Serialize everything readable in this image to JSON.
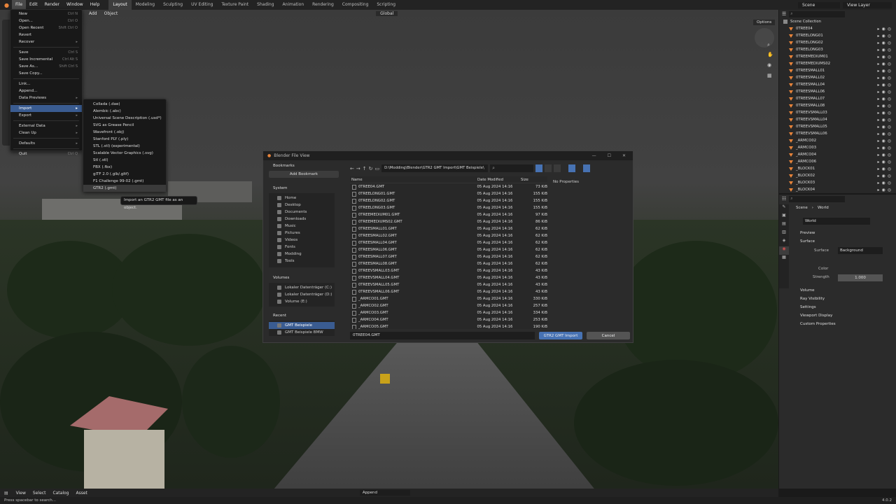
{
  "topbar": {
    "menus": [
      "File",
      "Edit",
      "Render",
      "Window",
      "Help"
    ],
    "workspaces": [
      "Layout",
      "Modeling",
      "Sculpting",
      "UV Editing",
      "Texture Paint",
      "Shading",
      "Animation",
      "Rendering",
      "Compositing",
      "Scripting"
    ],
    "scene": "Scene",
    "view_layer": "View Layer"
  },
  "viewport": {
    "add": "Add",
    "object": "Object",
    "orientation": "Global",
    "options": "Options"
  },
  "file_menu": [
    {
      "label": "New",
      "shortcut": "Ctrl N"
    },
    {
      "label": "Open...",
      "shortcut": "Ctrl O"
    },
    {
      "label": "Open Recent",
      "shortcut": "Shift Ctrl O"
    },
    {
      "label": "Revert",
      "shortcut": ""
    },
    {
      "label": "Recover",
      "shortcut": ""
    },
    {
      "label": "Save",
      "shortcut": "Ctrl S"
    },
    {
      "label": "Save Incremental",
      "shortcut": "Ctrl Alt S"
    },
    {
      "label": "Save As...",
      "shortcut": "Shift Ctrl S"
    },
    {
      "label": "Save Copy...",
      "shortcut": ""
    },
    {
      "label": "Link...",
      "shortcut": ""
    },
    {
      "label": "Append...",
      "shortcut": ""
    },
    {
      "label": "Data Previews",
      "shortcut": ""
    },
    {
      "label": "Import",
      "shortcut": ""
    },
    {
      "label": "Export",
      "shortcut": ""
    },
    {
      "label": "External Data",
      "shortcut": ""
    },
    {
      "label": "Clean Up",
      "shortcut": ""
    },
    {
      "label": "Defaults",
      "shortcut": ""
    },
    {
      "label": "Quit",
      "shortcut": "Ctrl Q"
    }
  ],
  "import_menu": [
    "Collada (.dae)",
    "Alembic (.abc)",
    "Universal Scene Description (.usd*)",
    "SVG as Grease Pencil",
    "Wavefront (.obj)",
    "Stanford PLY (.ply)",
    "STL (.stl) (experimental)",
    "Scalable Vector Graphics (.svg)",
    "Stl (.stl)",
    "FBX (.fbx)",
    "glTF 2.0 (.glb/.gltf)",
    "F1 Challenge 99-02 (.gmt)",
    "GTR2 (.gmt)"
  ],
  "tooltip": "Import an GTR2 GMT file as an object.",
  "dialog": {
    "title": "Blender File View",
    "path": "D:\\Modding\\Blender\\GTR2 GMT Import\\GMT Beispiele\\",
    "bookmarks": "Bookmarks",
    "add_bookmark": "Add Bookmark",
    "system": "System",
    "system_items": [
      "Home",
      "Desktop",
      "Documents",
      "Downloads",
      "Music",
      "Pictures",
      "Videos",
      "Fonts",
      "Modding",
      "Tools"
    ],
    "volumes": "Volumes",
    "volume_items": [
      "Lokaler Datenträger (C:)",
      "Lokaler Datenträger (D:)",
      "Volume (E:)"
    ],
    "recent": "Recent",
    "recent_items": [
      "GMT Beispiele",
      "GMT Beispiele BMW"
    ],
    "col_name": "Name",
    "col_date": "Date Modified",
    "col_size": "Size",
    "no_props": "No Properties",
    "files": [
      {
        "n": "0TREE04.GMT",
        "d": "05 Aug 2024 14:16",
        "s": "73 KiB"
      },
      {
        "n": "0TREELONG01.GMT",
        "d": "05 Aug 2024 14:16",
        "s": "155 KiB"
      },
      {
        "n": "0TREELONG02.GMT",
        "d": "05 Aug 2024 14:16",
        "s": "155 KiB"
      },
      {
        "n": "0TREELONG03.GMT",
        "d": "05 Aug 2024 14:16",
        "s": "155 KiB"
      },
      {
        "n": "0TREEMEDIUM01.GMT",
        "d": "05 Aug 2024 14:16",
        "s": "97 KiB"
      },
      {
        "n": "0TREEMEDIUMS02.GMT",
        "d": "05 Aug 2024 14:16",
        "s": "86 KiB"
      },
      {
        "n": "0TREESMALL01.GMT",
        "d": "05 Aug 2024 14:16",
        "s": "62 KiB"
      },
      {
        "n": "0TREESMALL02.GMT",
        "d": "05 Aug 2024 14:16",
        "s": "62 KiB"
      },
      {
        "n": "0TREESMALL04.GMT",
        "d": "05 Aug 2024 14:16",
        "s": "62 KiB"
      },
      {
        "n": "0TREESMALL06.GMT",
        "d": "05 Aug 2024 14:16",
        "s": "62 KiB"
      },
      {
        "n": "0TREESMALL07.GMT",
        "d": "05 Aug 2024 14:16",
        "s": "62 KiB"
      },
      {
        "n": "0TREESMALL08.GMT",
        "d": "05 Aug 2024 14:16",
        "s": "62 KiB"
      },
      {
        "n": "0TREEVSMALL03.GMT",
        "d": "05 Aug 2024 14:16",
        "s": "43 KiB"
      },
      {
        "n": "0TREEVSMALL04.GMT",
        "d": "05 Aug 2024 14:16",
        "s": "43 KiB"
      },
      {
        "n": "0TREEVSMALL05.GMT",
        "d": "05 Aug 2024 14:16",
        "s": "43 KiB"
      },
      {
        "n": "0TREEVSMALL06.GMT",
        "d": "05 Aug 2024 14:16",
        "s": "43 KiB"
      },
      {
        "n": "_ARMCO01.GMT",
        "d": "05 Aug 2024 14:16",
        "s": "330 KiB"
      },
      {
        "n": "_ARMCO02.GMT",
        "d": "05 Aug 2024 14:16",
        "s": "257 KiB"
      },
      {
        "n": "_ARMCO03.GMT",
        "d": "05 Aug 2024 14:16",
        "s": "334 KiB"
      },
      {
        "n": "_ARMCO04.GMT",
        "d": "05 Aug 2024 14:16",
        "s": "253 KiB"
      },
      {
        "n": "_ARMCO05.GMT",
        "d": "05 Aug 2024 14:16",
        "s": "190 KiB"
      }
    ],
    "filename": "0TREE04.GMT",
    "import_btn": "GTR2 GMT Import",
    "cancel_btn": "Cancel"
  },
  "outliner": {
    "root": "Scene Collection",
    "items": [
      "0TREE04",
      "0TREELONG01",
      "0TREELONG02",
      "0TREELONG03",
      "0TREEMEDIUM01",
      "0TREEMEDIUMS02",
      "0TREESMALL01",
      "0TREESMALL02",
      "0TREESMALL04",
      "0TREESMALL06",
      "0TREESMALL07",
      "0TREESMALL08",
      "0TREEVSMALL03",
      "0TREEVSMALL04",
      "0TREEVSMALL05",
      "0TREEVSMALL06",
      "_ARMCO02",
      "_ARMCO03",
      "_ARMCO04",
      "_ARMCO06",
      "_BLOCK01",
      "_BLOCK02",
      "_BLOCK03",
      "_BLOCK04"
    ]
  },
  "props": {
    "scene": "Scene",
    "world": "World",
    "world_name": "World",
    "preview": "Preview",
    "surface": "Surface",
    "surface_label": "Surface",
    "surface_value": "Background",
    "color_label": "Color",
    "strength_label": "Strength",
    "strength_value": "1.000",
    "sections": [
      "Volume",
      "Ray Visibility",
      "Settings",
      "Viewport Display",
      "Custom Properties"
    ]
  },
  "bottom": {
    "menus": [
      "View",
      "Select",
      "Catalog",
      "Asset"
    ],
    "append": "Append"
  },
  "status": {
    "hint": "Press spacebar to search...",
    "version": "4.0.2"
  }
}
